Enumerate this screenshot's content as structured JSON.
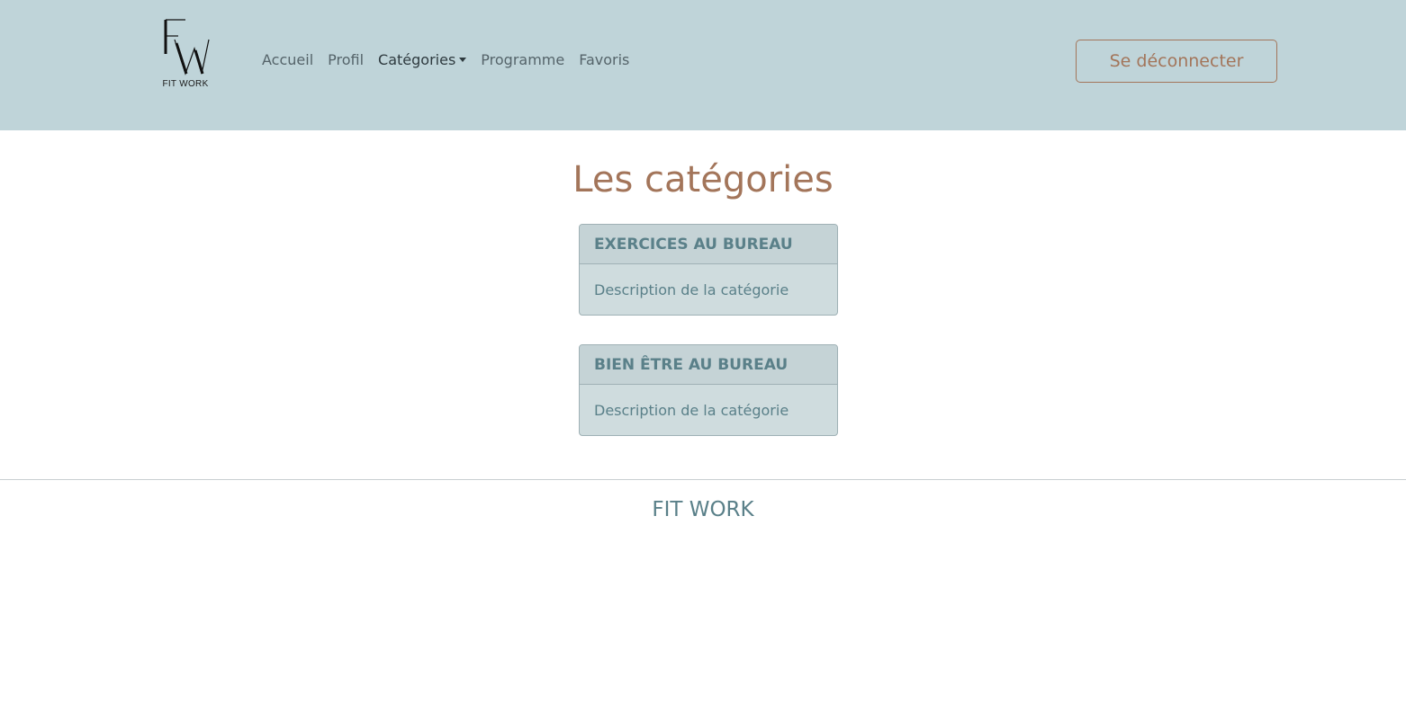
{
  "header": {
    "logo": {
      "letters": "FW",
      "text": "FIT WORK"
    },
    "nav": [
      {
        "label": "Accueil"
      },
      {
        "label": "Profil"
      },
      {
        "label": "Catégories",
        "has_dropdown": true,
        "active": true
      },
      {
        "label": "Programme"
      },
      {
        "label": "Favoris"
      }
    ],
    "logout_label": "Se déconnecter"
  },
  "main": {
    "title": "Les catégories",
    "categories": [
      {
        "name": "EXERCICES AU BUREAU",
        "description": "Description de la catégorie"
      },
      {
        "name": "BIEN ÊTRE AU BUREAU",
        "description": "Description de la catégorie"
      }
    ]
  },
  "footer": {
    "title": "FIT WORK"
  },
  "colors": {
    "navbar_bg": "#bfd4d9",
    "accent": "#a3755a",
    "card_text": "#5a8089",
    "card_bg": "#cfdcde"
  }
}
